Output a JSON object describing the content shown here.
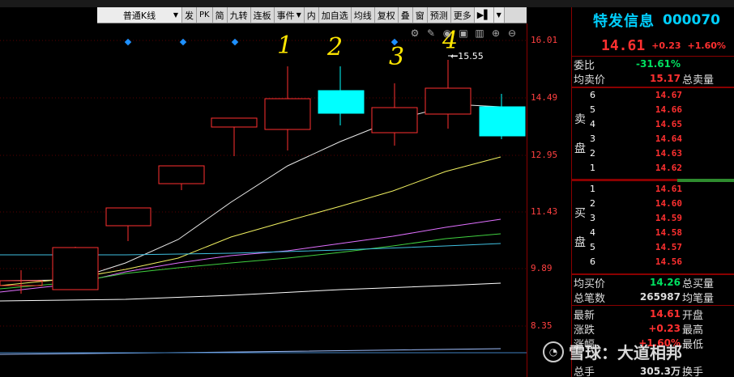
{
  "toolbar": {
    "chart_type": "普通K线",
    "buttons": [
      "发",
      "PK",
      "简",
      "九转",
      "连板",
      "事件",
      "内",
      "加自选",
      "均线",
      "复权",
      "叠",
      "窗",
      "预测",
      "更多"
    ]
  },
  "price_axis": {
    "ticks": [
      "16.01",
      "14.49",
      "12.95",
      "11.43",
      "9.89",
      "8.35"
    ]
  },
  "annotation": {
    "high_label": "←15.55",
    "handwritten": [
      "1",
      "2",
      "3",
      "4"
    ]
  },
  "stock": {
    "name": "特发信息",
    "code": "000070",
    "last": "14.61",
    "change": "+0.23",
    "change_pct": "+1.60%"
  },
  "summary": {
    "weibi_label": "委比",
    "weibi_value": "-31.61%",
    "avg_ask_label": "均卖价",
    "avg_ask_value": "15.17",
    "total_ask_label": "总卖量"
  },
  "ask_side_label": [
    "卖",
    "盘"
  ],
  "asks": [
    {
      "level": "6",
      "price": "14.67"
    },
    {
      "level": "5",
      "price": "14.66"
    },
    {
      "level": "4",
      "price": "14.65"
    },
    {
      "level": "3",
      "price": "14.64"
    },
    {
      "level": "2",
      "price": "14.63"
    },
    {
      "level": "1",
      "price": "14.62"
    }
  ],
  "bid_side_label": [
    "买",
    "盘"
  ],
  "bids": [
    {
      "level": "1",
      "price": "14.61"
    },
    {
      "level": "2",
      "price": "14.60"
    },
    {
      "level": "3",
      "price": "14.59"
    },
    {
      "level": "4",
      "price": "14.58"
    },
    {
      "level": "5",
      "price": "14.57"
    },
    {
      "level": "6",
      "price": "14.56"
    }
  ],
  "bottom": {
    "avg_bid_label": "均买价",
    "avg_bid_value": "14.26",
    "total_bid_label": "总买量",
    "trades_label": "总笔数",
    "trades_value": "265987",
    "avg_trade_label": "均笔量",
    "latest_label": "最新",
    "latest_value": "14.61",
    "open_label": "开盘",
    "change_label": "涨跌",
    "change_value": "+0.23",
    "high_label": "最高",
    "pct_label": "涨幅",
    "pct_value": "+1.60%",
    "low_label": "最低",
    "volume_label": "总手",
    "volume_value": "305.3万",
    "turnover_label": "换手"
  },
  "watermark": "雪球：大道相邦",
  "colors": {
    "up": "#ff3030",
    "down": "#00ffff",
    "axis_text": "#ff4040",
    "name": "#00d0ff",
    "bid_green": "#00e060"
  }
}
